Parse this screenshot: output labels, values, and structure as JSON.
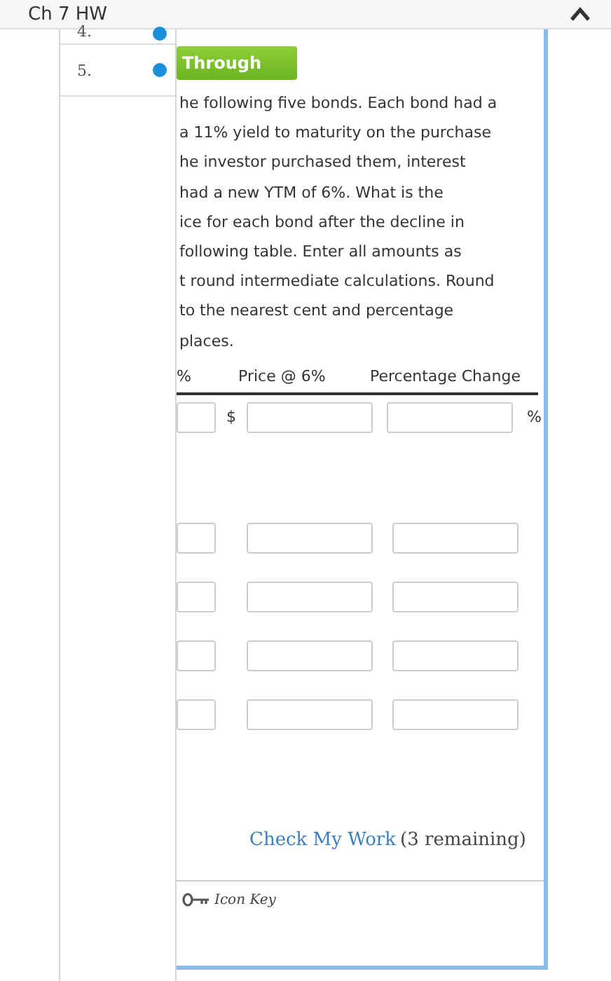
{
  "header": {
    "title": "Ch 7 HW"
  },
  "nav": {
    "items": [
      {
        "label": "4."
      },
      {
        "label": "5."
      }
    ]
  },
  "question": {
    "button": "Through",
    "lines": [
      "he following five bonds. Each bond had a",
      "a 11% yield to maturity on the purchase",
      "he investor purchased them, interest",
      "had a new YTM of 6%. What is the",
      "ice for each bond after the decline in",
      "following table. Enter all amounts as",
      "t round intermediate calculations. Round",
      "to the nearest cent and percentage",
      "places."
    ]
  },
  "table": {
    "columns": [
      "%",
      "Price @ 6%",
      "Percentage Change"
    ],
    "rows": [
      {
        "kind": "first",
        "currency": "$",
        "unit": "%"
      },
      {
        "kind": "plain"
      },
      {
        "kind": "plain"
      },
      {
        "kind": "plain"
      },
      {
        "kind": "plain"
      }
    ]
  },
  "check": {
    "link": "Check My Work",
    "remaining": "(3 remaining)"
  },
  "icon_key": {
    "label": "Icon Key"
  }
}
